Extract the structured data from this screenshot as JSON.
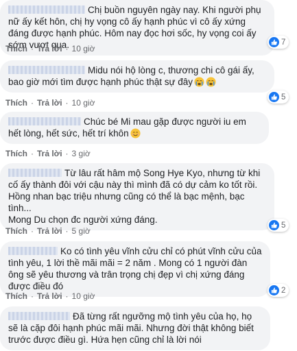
{
  "comments": [
    {
      "text": "Chị buồn nguyên ngày nay. Khi người phụ nữ ấy kết hôn, chị hy vọng cô ấy hạnh phúc vì cô ấy xứng đáng được hạnh phúc. Hôm nay đọc hơi sốc, hy vọng coi ấy sớm vượt qua.",
      "like_label": "Thích",
      "reply_label": "Trả lời",
      "time": "10 giờ",
      "reaction_count": "7"
    },
    {
      "text": "Midu nói hộ lòng c, thương chi cô gái ấy, bao giờ mới tìm được hạnh phúc thật sự đây",
      "emojis": [
        "crying-face-icon",
        "crying-face-icon"
      ],
      "like_label": "Thích",
      "reply_label": "Trả lời",
      "time": "10 giờ",
      "reaction_count": "5"
    },
    {
      "text": "Chúc bé Mi mau gặp được người iu em hết lòng, hết sức, hết trí khôn",
      "emojis": [
        "smiling-face-icon"
      ],
      "like_label": "Thích",
      "reply_label": "Trả lời",
      "time": "3 giờ"
    },
    {
      "text": "Từ lâu rất hâm mộ Song Hye Kyo, nhưng từ khi cố ấy thành đôi với cậu này thì mình đã có dự cảm ko tốt rồi. Hồng nhan bạc triệu nhưng cũng có thể là bạc mệnh, bạc tình...\nMong Du chọn đc người xứng đáng.",
      "like_label": "Thích",
      "reply_label": "Trả lời",
      "time": "5 giờ",
      "reaction_count": "5"
    },
    {
      "text": "Ko có tình yêu vĩnh cửu chỉ có phút vĩnh cửu của tình yêu, 1 lời thề mãi mãi = 2 năm . Mong có 1 người đàn ông sẽ yêu thương và trân trọng chị đẹp vì chị xứng đáng được điều đó",
      "like_label": "Thích",
      "reply_label": "Trả lời",
      "time": "10 giờ",
      "reaction_count": "2"
    },
    {
      "text": "Đã từng rất ngưỡng mộ tình yêu của họ, họ sẽ là cặp đôi hạnh phúc mãi mãi. Nhưng đời thật không biết trước được điều gì. Hứa hẹn cũng chỉ là lời nói",
      "like_label": "Thích",
      "reply_label": "Trả lời",
      "time": "11 giờ"
    }
  ]
}
